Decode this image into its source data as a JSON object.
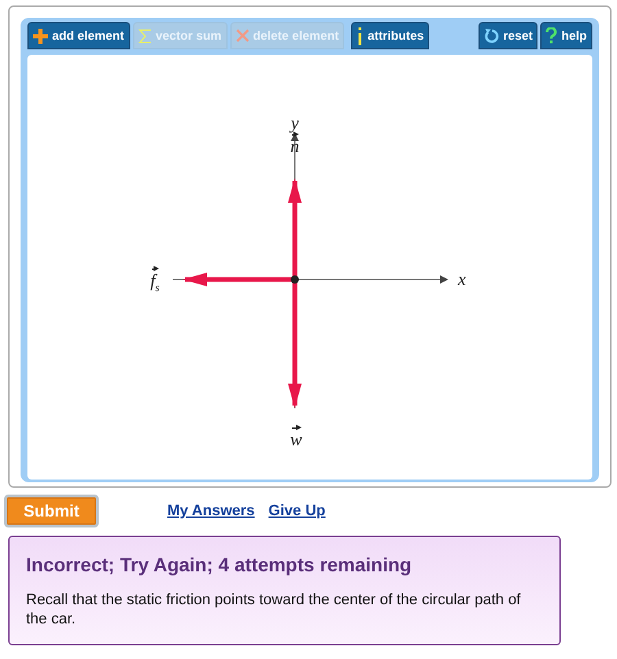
{
  "toolbar": {
    "left": [
      {
        "label": "add element",
        "kind": "plus",
        "disabled": false
      },
      {
        "label": "vector sum",
        "kind": "sigma",
        "disabled": true
      },
      {
        "label": "delete element",
        "kind": "cross",
        "disabled": true
      },
      {
        "label": "attributes",
        "kind": "info",
        "disabled": false
      }
    ],
    "right": [
      {
        "label": "reset",
        "kind": "reset",
        "disabled": false
      },
      {
        "label": "help",
        "kind": "question",
        "disabled": false
      }
    ]
  },
  "diagram": {
    "x_axis": "x",
    "y_axis": "y",
    "vectors": [
      {
        "label": "n",
        "kind": "up"
      },
      {
        "label": "f$_{s}$",
        "kind": "left"
      },
      {
        "label": "w",
        "kind": "down"
      }
    ]
  },
  "submit": "Submit",
  "links": [
    "My Answers",
    "Give Up"
  ],
  "feedback": {
    "title": "Incorrect; Try Again; 4 attempts remaining",
    "message": "Recall that the static friction points toward the center of the circular path of the car."
  }
}
